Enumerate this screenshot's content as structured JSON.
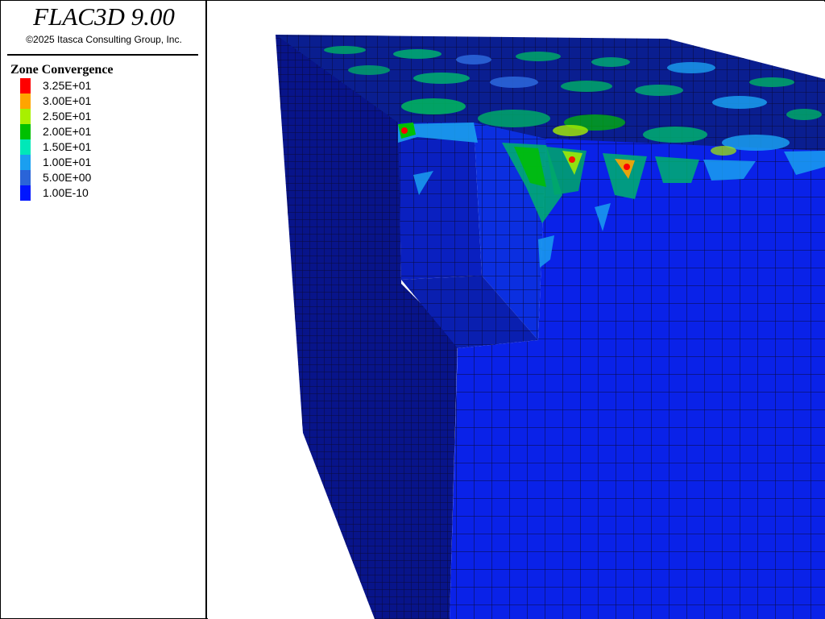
{
  "app": {
    "title": "FLAC3D 9.00",
    "copyright": "©2025 Itasca Consulting Group, Inc."
  },
  "legend": {
    "title": "Zone Convergence",
    "items": [
      {
        "label": "3.25E+01",
        "color": "#ff0000"
      },
      {
        "label": "3.00E+01",
        "color": "#ffa500"
      },
      {
        "label": "2.50E+01",
        "color": "#a8f000"
      },
      {
        "label": "2.00E+01",
        "color": "#00c000"
      },
      {
        "label": "1.50E+01",
        "color": "#00e8b8"
      },
      {
        "label": "1.00E+01",
        "color": "#1a9ff0"
      },
      {
        "label": "5.00E+00",
        "color": "#2a64d8"
      },
      {
        "label": "1.00E-10",
        "color": "#0016ff"
      }
    ]
  },
  "model": {
    "colors": {
      "mesh_line": "#0a0a3a",
      "left_face": "#08148a",
      "top_face": "#0a1e90",
      "front_face": "#0a22e8",
      "cut_back": "#0a20c0",
      "cut_side": "#0b2fe0",
      "cut_floor": "#0a1fb0"
    }
  }
}
